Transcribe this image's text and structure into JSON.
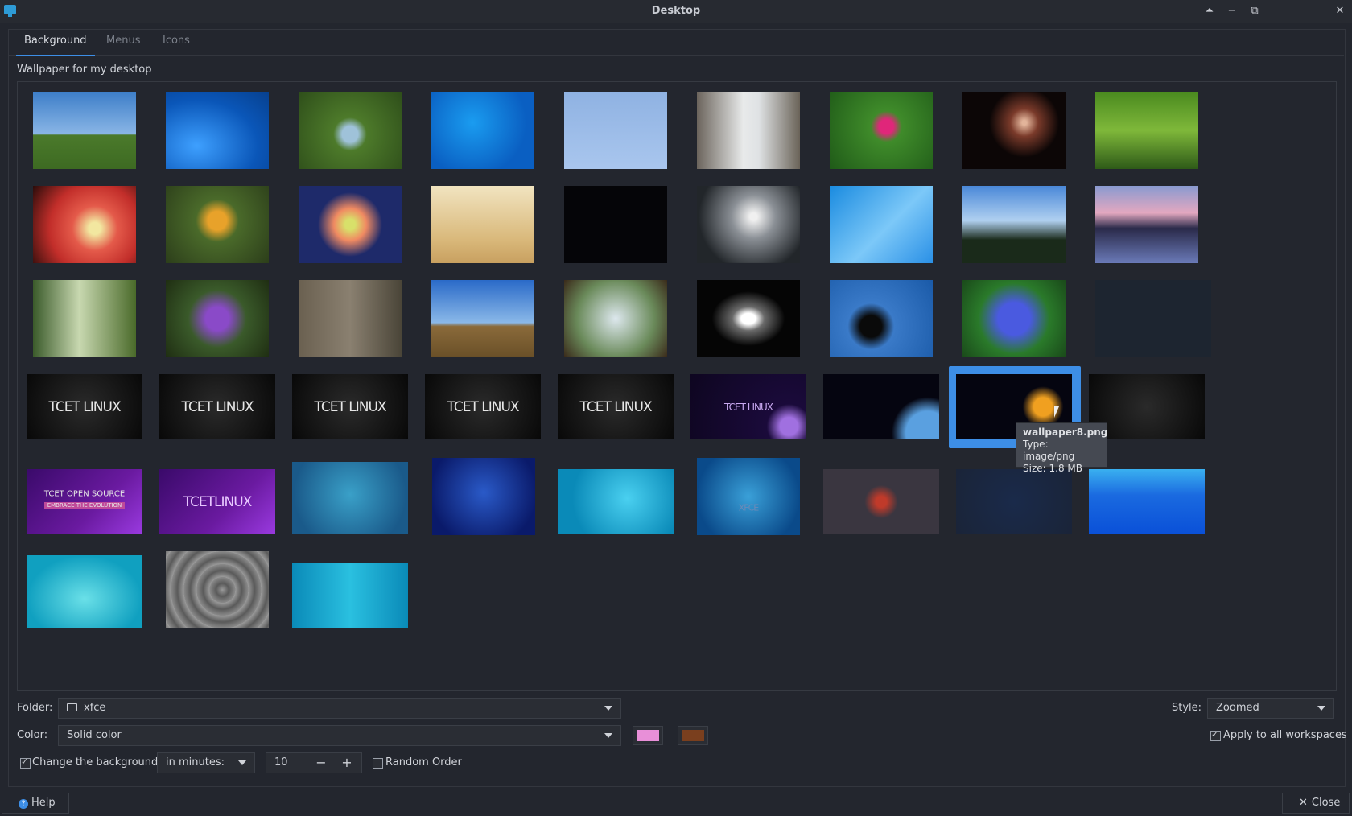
{
  "window": {
    "title": "Desktop"
  },
  "tabs": [
    {
      "label": "Background",
      "active": true
    },
    {
      "label": "Menus",
      "active": false
    },
    {
      "label": "Icons",
      "active": false
    }
  ],
  "wallpaper_label": "Wallpaper for my desktop",
  "thumbnails": {
    "row4_text": [
      "TCET LINUX",
      "TCET LINUX",
      "TCET LINUX",
      "TCET LINUX",
      "TCET LINUX",
      "TCET LINUX"
    ],
    "row5_text": [
      "TCET OPEN SOURCE",
      "EMBRACE THE EVOLUTION",
      "TCETLINUX",
      "XFCE"
    ]
  },
  "tooltip": {
    "name": "wallpaper8.png",
    "type": "Type: image/png",
    "size": "Size: 1.8 MB"
  },
  "folder": {
    "label": "Folder:",
    "value": "xfce"
  },
  "style": {
    "label": "Style:",
    "value": "Zoomed"
  },
  "color": {
    "label": "Color:",
    "value": "Solid color",
    "color1": "#e88fd8",
    "color2": "#7a3f1e"
  },
  "apply_all": {
    "label": "Apply to all workspaces",
    "checked": true
  },
  "change_bg": {
    "label": "Change the background",
    "checked": true
  },
  "interval": {
    "unit": "in minutes:",
    "value": "10",
    "minus": "−",
    "plus": "+"
  },
  "random_order": {
    "label": "Random Order",
    "checked": false
  },
  "buttons": {
    "help": "Help",
    "close": "Close"
  },
  "icons": {
    "help": "help-icon",
    "close": "close-icon",
    "folder": "folder-icon"
  }
}
